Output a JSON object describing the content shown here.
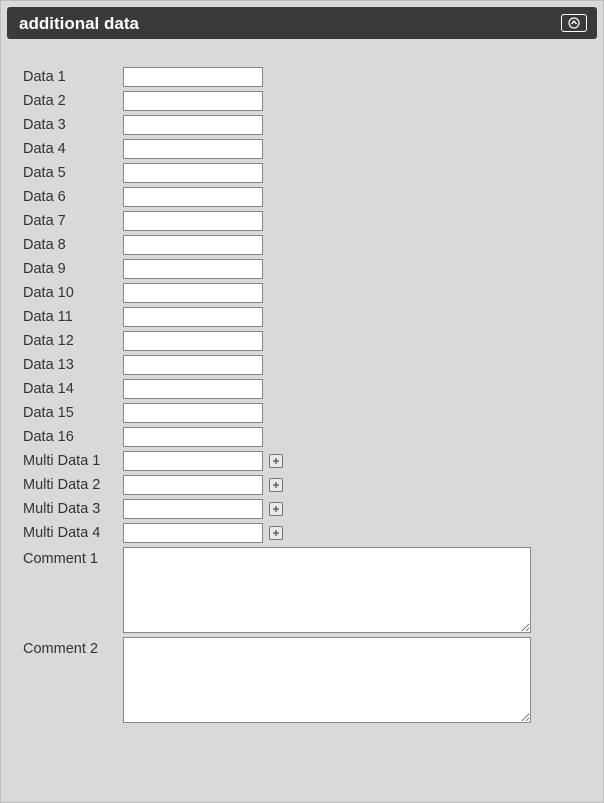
{
  "panel": {
    "title": "additional data"
  },
  "fields": {
    "data": [
      {
        "label": "Data 1",
        "value": ""
      },
      {
        "label": "Data 2",
        "value": ""
      },
      {
        "label": "Data 3",
        "value": ""
      },
      {
        "label": "Data 4",
        "value": ""
      },
      {
        "label": "Data 5",
        "value": ""
      },
      {
        "label": "Data 6",
        "value": ""
      },
      {
        "label": "Data 7",
        "value": ""
      },
      {
        "label": "Data 8",
        "value": ""
      },
      {
        "label": "Data 9",
        "value": ""
      },
      {
        "label": "Data 10",
        "value": ""
      },
      {
        "label": "Data 11",
        "value": ""
      },
      {
        "label": "Data 12",
        "value": ""
      },
      {
        "label": "Data 13",
        "value": ""
      },
      {
        "label": "Data 14",
        "value": ""
      },
      {
        "label": "Data 15",
        "value": ""
      },
      {
        "label": "Data 16",
        "value": ""
      }
    ],
    "multi": [
      {
        "label": "Multi Data 1",
        "value": ""
      },
      {
        "label": "Multi Data 2",
        "value": ""
      },
      {
        "label": "Multi Data 3",
        "value": ""
      },
      {
        "label": "Multi Data 4",
        "value": ""
      }
    ],
    "comments": [
      {
        "label": "Comment 1",
        "value": ""
      },
      {
        "label": "Comment 2",
        "value": ""
      }
    ]
  }
}
